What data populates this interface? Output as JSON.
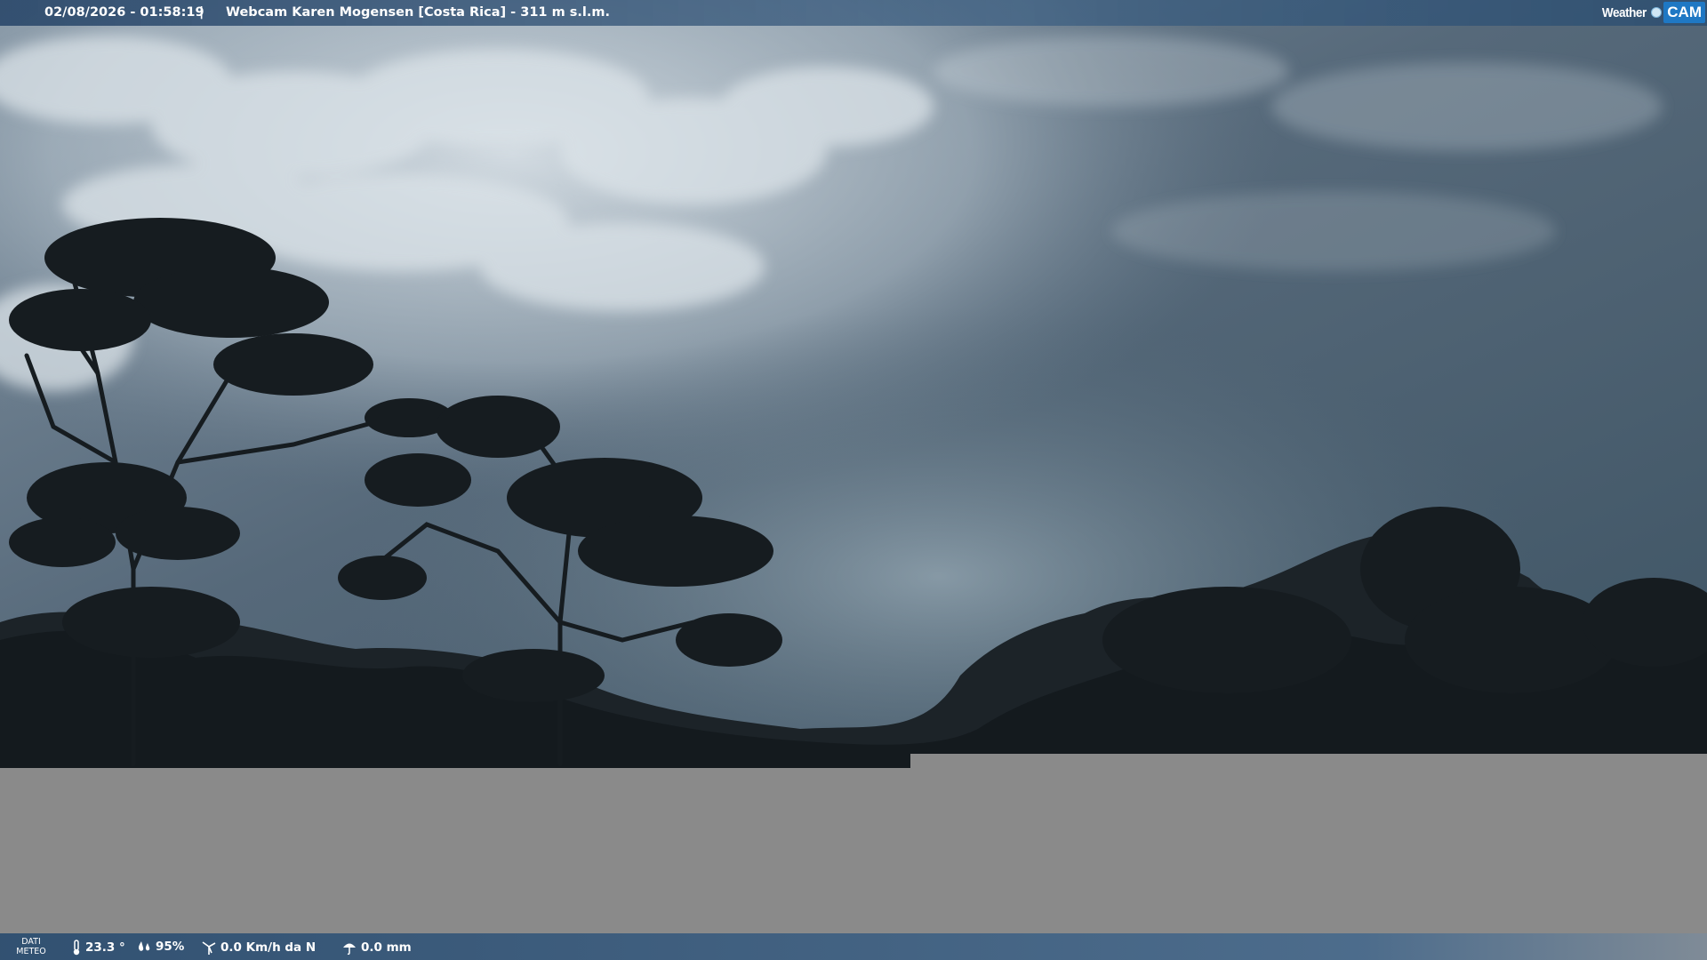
{
  "overlay": {
    "datetime": "02/08/2026 - 01:58:19",
    "separator": "|",
    "title": "Webcam Karen Mogensen [Costa Rica]  - 311 m s.l.m."
  },
  "logo": {
    "part1": "Weather",
    "part2": "CAM"
  },
  "weather_bar": {
    "label_line1": "DATI",
    "label_line2": "METEO",
    "temperature": "23.3 °",
    "humidity": "95%",
    "wind": "0.0 Km/h da N",
    "rain": "0.0 mm"
  },
  "colors": {
    "sky_light": "#c9d4dc",
    "sky_dark": "#3f5666",
    "foliage": "#1a2126",
    "gray_fill": "#8a8a8a",
    "bar_blue": "#2d4e70"
  }
}
